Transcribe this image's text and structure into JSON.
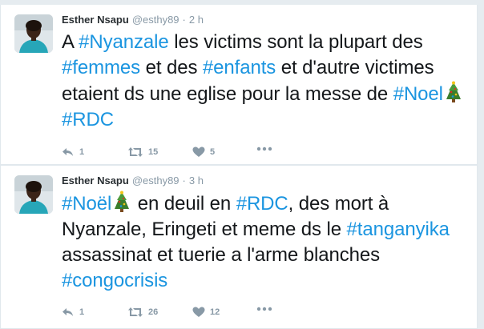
{
  "tweets": [
    {
      "author": {
        "name": "Esther Nsapu",
        "handle": "@esthy89"
      },
      "time": "2 h",
      "text": {
        "p1": "A ",
        "h1": "#Nyanzale",
        "p2": " les victims sont la plupart des ",
        "h2": "#femmes",
        "p3": " et des ",
        "h3": "#enfants",
        "p4": " et d'autre victimes  etaient ds une eglise pour la messe de ",
        "h4": "#Noel",
        "h5": "#RDC"
      },
      "counts": {
        "reply": "1",
        "retweet": "15",
        "like": "5"
      }
    },
    {
      "author": {
        "name": "Esther Nsapu",
        "handle": "@esthy89"
      },
      "time": "3 h",
      "text": {
        "h1": "#Noël",
        "p1": " en deuil en ",
        "h2": "#RDC",
        "p2": ", des mort à Nyanzale, Eringeti et meme ds le ",
        "h3": "#tanganyika",
        "p3": " assassinat et tuerie a l'arme blanches ",
        "h4": "#congocrisis"
      },
      "counts": {
        "reply": "1",
        "retweet": "26",
        "like": "12"
      }
    }
  ],
  "separator": "·",
  "icons": {
    "reply": "reply-icon",
    "retweet": "retweet-icon",
    "like": "heart-icon",
    "more": "more-dots-icon",
    "emoji": "christmas-tree-emoji"
  },
  "colors": {
    "hashtag": "#1b95e0",
    "text": "#14171a",
    "meta": "#8899a6",
    "background": "#e6ecf0"
  }
}
